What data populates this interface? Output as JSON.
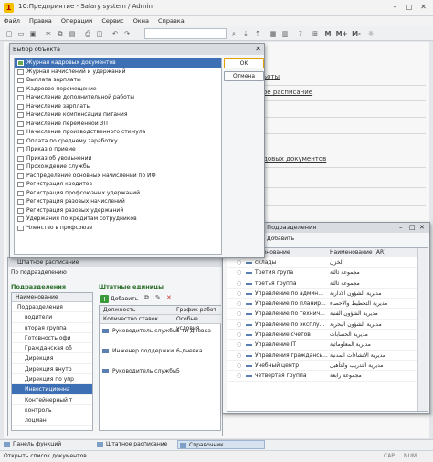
{
  "window": {
    "title": "1С:Предприятие - Salary system / Admin"
  },
  "menu": [
    "Файл",
    "Правка",
    "Операции",
    "Сервис",
    "Окна",
    "Справка"
  ],
  "toolbar": {
    "right_labels": [
      "M",
      "M+",
      "M-"
    ]
  },
  "background_links": [
    "ьоты",
    "ое расписание",
    "довых документов"
  ],
  "dialog": {
    "title": "Выбор объекта",
    "items": [
      "Журнал кадровых документов",
      "Журнал начислений и удержаний",
      "Выплата зарплаты",
      "Кадровое перемещение",
      "Начисление дополнительной работы",
      "Начисление зарплаты",
      "Начисление компенсации питания",
      "Начисление переменной ЗП",
      "Начисление производственного стимула",
      "Оплата по среднему заработку",
      "Приказ о приеме",
      "Приказ об увольнении",
      "Прохождение службы",
      "Распределение основных начислений по ИФ",
      "Регистрация кредитов",
      "Регистрация профсоюзных удержаний",
      "Регистрация разовых начислений",
      "Регистрация разовых удержаний",
      "Удержания по кредитам сотрудников",
      "Членство в профсоюзе"
    ],
    "selected_index": 0,
    "ok_label": "OK",
    "cancel_label": "Отмена"
  },
  "staff": {
    "title": "Штатное расписание",
    "mode": "По подразделению",
    "departments_title": "Подразделения",
    "departments_header": "Наименование",
    "departments": [
      "Подразделения",
      "водители",
      "вторая группа",
      "Готовность офи",
      "Гражданская об",
      "Дирекция",
      "Дирекция внутр",
      "Дирекция по упр",
      "Инвестиционна",
      "Контейнерный т",
      "контроль",
      "лоцман"
    ],
    "units_title": "Штатные единицы",
    "add_label": "Добавить",
    "col_position": "Должность",
    "col_schedule": "График работ",
    "col_count": "Количество ставок",
    "col_conditions": "Особые условия",
    "units": [
      {
        "position": "Руководитель службы",
        "schedule": "5-ти дневка"
      },
      {
        "position": "Инженер поддержки",
        "schedule": "6-дневка"
      },
      {
        "position": "Руководитель службы",
        "schedule": "5"
      }
    ]
  },
  "subdiv": {
    "title": "к: Подразделения",
    "add_label": "Добавить",
    "col_name": "Наименование",
    "col_name_ar": "Наименование (AR)",
    "rows": [
      {
        "name": "склады",
        "ar": "الخزن"
      },
      {
        "name": "Третия група",
        "ar": "مجموعة ثالثة"
      },
      {
        "name": "третья группа",
        "ar": "مجموعة ثالثة"
      },
      {
        "name": "Управление по админ...",
        "ar": "مديرية الشؤون الادارية"
      },
      {
        "name": "Управление по планир...",
        "ar": "مديرية التخطيط والاحصاء"
      },
      {
        "name": "Управление по технич...",
        "ar": "مديرية الشؤون الفنية"
      },
      {
        "name": "Управление по эксплу...",
        "ar": "مديرية الشؤون البحرية"
      },
      {
        "name": "Управление счетов",
        "ar": "مديرية الحسابات"
      },
      {
        "name": "Управление IT",
        "ar": "مديرية المعلوماتية"
      },
      {
        "name": "Управления граждансь...",
        "ar": "مديرية الانشاءات المدنية"
      },
      {
        "name": "Учебный центр",
        "ar": "مديرية التدريب والتأهيل"
      },
      {
        "name": "четвёртая группа",
        "ar": "مجموعة رابعة"
      }
    ]
  },
  "taskbar": [
    "Панель функций",
    "Штатное расписание",
    "Справочник Подразделения"
  ],
  "status": {
    "text": "Открыть список документов",
    "cap": "CAP",
    "num": "NUM"
  }
}
